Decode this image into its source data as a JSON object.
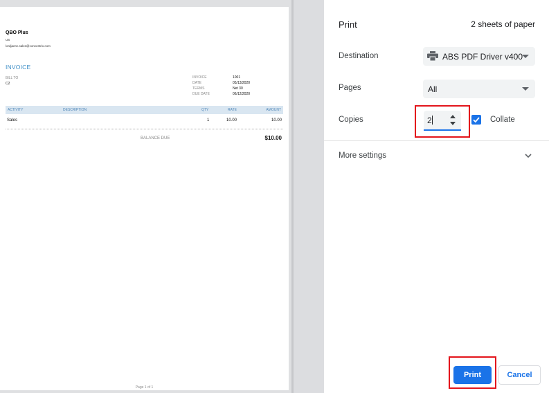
{
  "invoice": {
    "company": "QBO Plus",
    "country": "US",
    "email": "lordjaenc.sales@concentrix.com",
    "title": "INVOICE",
    "bill_to_label": "BILL TO",
    "bill_to_value": "C2",
    "meta": [
      {
        "label": "INVOICE",
        "value": "1001"
      },
      {
        "label": "DATE",
        "value": "05/13/2020"
      },
      {
        "label": "TERMS",
        "value": "Net 30"
      },
      {
        "label": "DUE DATE",
        "value": "06/12/2020"
      }
    ],
    "columns": {
      "activity": "ACTIVITY",
      "description": "DESCRIPTION",
      "qty": "QTY",
      "rate": "RATE",
      "amount": "AMOUNT"
    },
    "row": {
      "activity": "Sales",
      "qty": "1",
      "rate": "10.00",
      "amount": "10.00"
    },
    "balance_due_label": "BALANCE DUE",
    "balance_due_value": "$10.00",
    "page_number": "Page 1 of 1"
  },
  "print_panel": {
    "title": "Print",
    "sheets": "2 sheets of paper",
    "destination_label": "Destination",
    "destination_value": "ABS PDF Driver v400",
    "pages_label": "Pages",
    "pages_value": "All",
    "copies_label": "Copies",
    "copies_value": "2",
    "collate_label": "Collate",
    "collate_checked": true,
    "more_settings_label": "More settings",
    "print_button": "Print",
    "cancel_button": "Cancel"
  },
  "colors": {
    "accent": "#1a73e8",
    "highlight": "#e3141b",
    "invoice_header": "#3d8ec7"
  },
  "icons": [
    "printer-icon",
    "chevron-down-icon",
    "check-icon",
    "spin-up-icon",
    "spin-down-icon"
  ]
}
